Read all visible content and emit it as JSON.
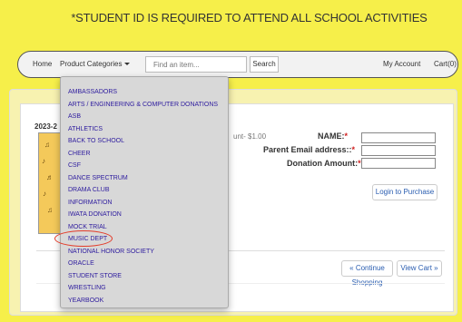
{
  "banner": {
    "text": "*STUDENT ID IS REQUIRED TO ATTEND ALL SCHOOL ACTIVITIES"
  },
  "nav": {
    "home": "Home",
    "product_categories": "Product Categories",
    "search_placeholder": "Find an item...",
    "search_button": "Search",
    "my_account": "My Account",
    "cart": "Cart(0)"
  },
  "product": {
    "year_label": "2023-2",
    "price_text": "unt- $1.00",
    "name_label": "NAME:",
    "email_label": "Parent Email address::",
    "donation_label": "Donation Amount:",
    "required_mark": "*",
    "login_button": "Login to Purchase",
    "continue_button": "« Continue Shopping",
    "view_cart_button": "View Cart »"
  },
  "dropdown": {
    "items": [
      "AMBASSADORS",
      "ARTS / ENGINEERING & COMPUTER DONATIONS",
      "ASB",
      "ATHLETICS",
      "BACK TO SCHOOL",
      "CHEER",
      "CSF",
      "DANCE SPECTRUM",
      "DRAMA CLUB",
      "INFORMATION",
      "IWATA DONATION",
      "MOCK TRIAL",
      "MUSIC DEPT",
      "NATIONAL HONOR SOCIETY",
      "ORACLE",
      "STUDENT STORE",
      "WRESTLING",
      "YEARBOOK"
    ]
  },
  "colors": {
    "background": "#f6ef4a",
    "link": "#2d1b9e",
    "highlight_circle": "#e33c2a"
  }
}
